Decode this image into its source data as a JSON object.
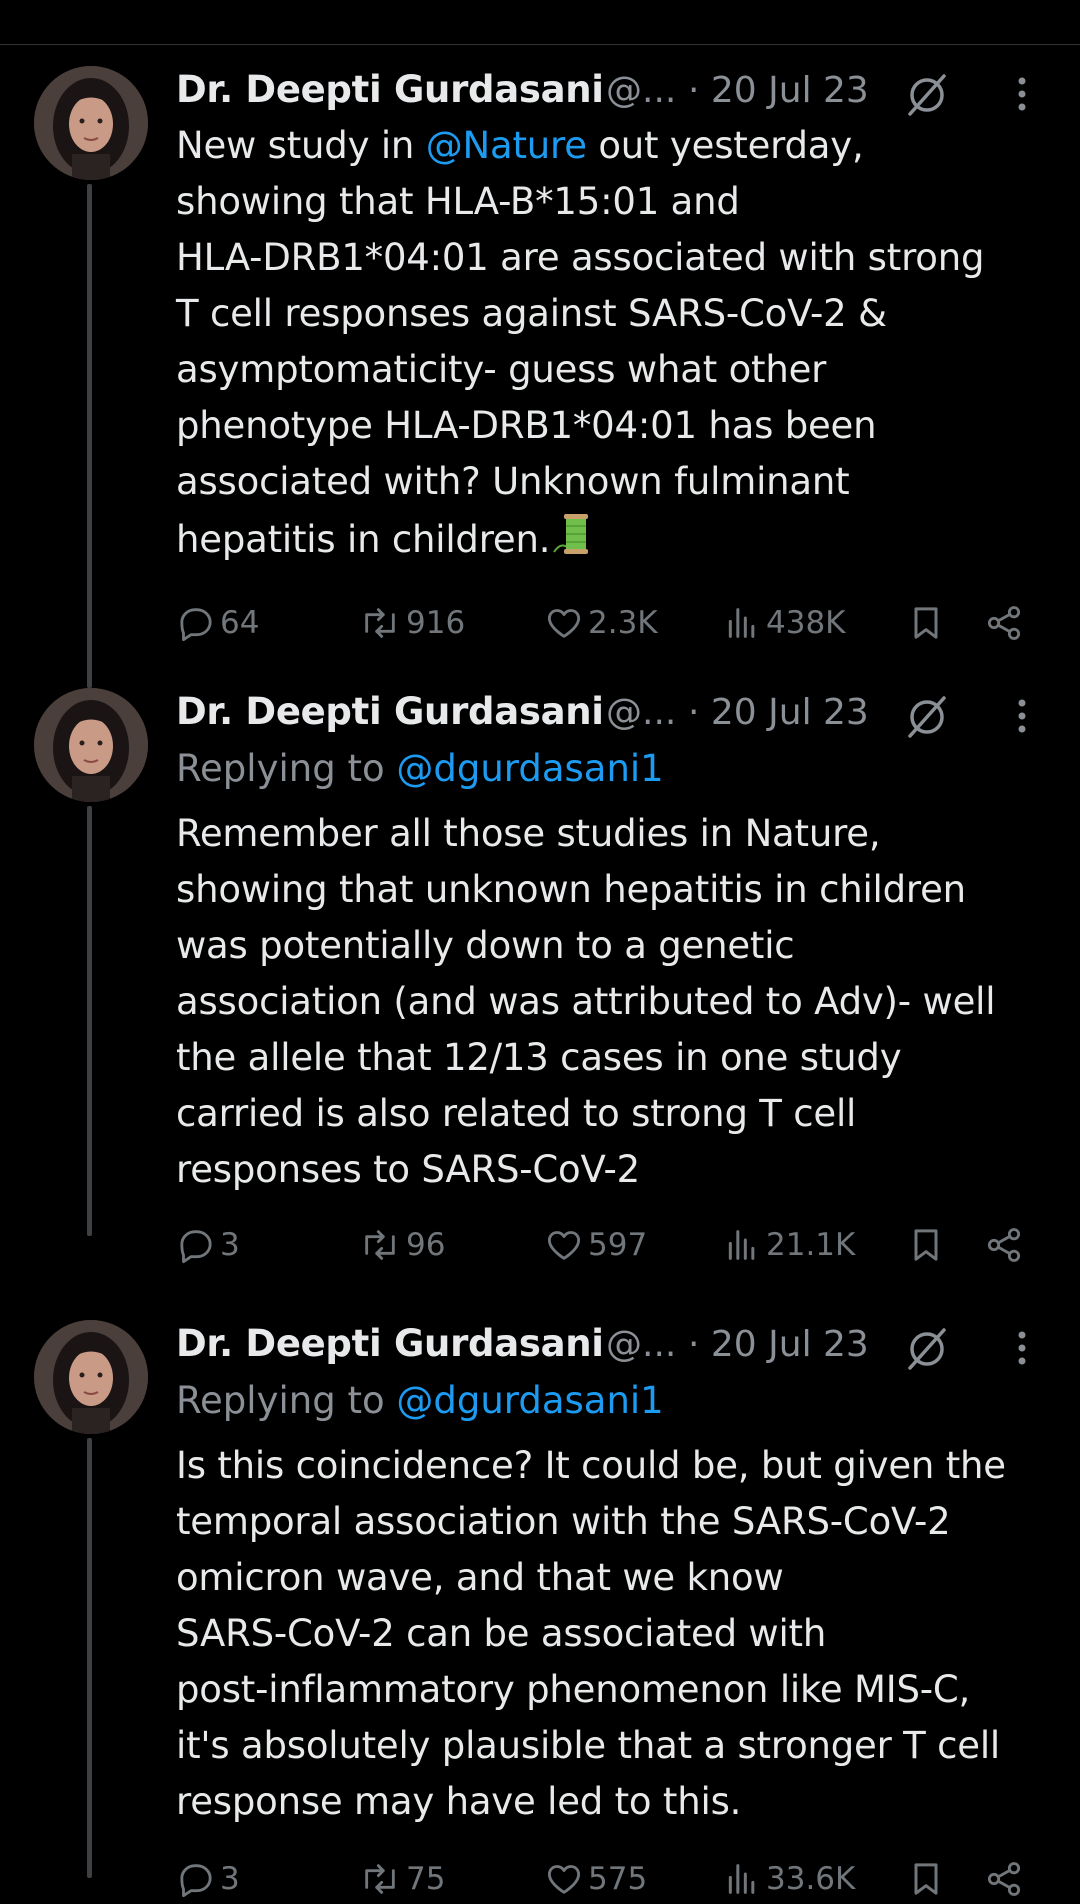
{
  "colors": {
    "background": "#000000",
    "text": "#e7e9ea",
    "secondary": "#8b9096",
    "link": "#1d9bf0",
    "thread_line": "#3e4144"
  },
  "tweets": [
    {
      "author": "Dr. Deepti Gurdasani",
      "handle": "@...",
      "date": "· 20 Jul 23",
      "replying_prefix": "",
      "replying_handle": "",
      "text_mention": "@Nature",
      "text_before": "New study in ",
      "text_after": " out yesterday,\nshowing that HLA-B*15:01 and\nHLA-DRB1*04:01 are associated with strong\nT cell responses against SARS-CoV-2 &\nasymptomaticity- guess what other\nphenotype HLA-DRB1*04:01 has been\nassociated with? Unknown fulminant\nhepatitis in children.",
      "emoji": "thread-spool",
      "replies": "64",
      "reposts": "916",
      "likes": "2.3K",
      "views": "438K"
    },
    {
      "author": "Dr. Deepti Gurdasani",
      "handle": "@...",
      "date": "· 20 Jul 23",
      "replying_prefix": "Replying to ",
      "replying_handle": "@dgurdasani1",
      "text": "Remember all those studies in Nature,\nshowing that unknown hepatitis in children\nwas potentially down to a genetic\nassociation (and was attributed to Adv)- well\nthe allele that 12/13 cases in one study\ncarried is also related to strong T cell\nresponses to SARS-CoV-2",
      "replies": "3",
      "reposts": "96",
      "likes": "597",
      "views": "21.1K"
    },
    {
      "author": "Dr. Deepti Gurdasani",
      "handle": "@...",
      "date": "· 20 Jul 23",
      "replying_prefix": "Replying to ",
      "replying_handle": "@dgurdasani1",
      "text": "Is this coincidence? It could be, but given the\ntemporal association with the SARS-CoV-2\nomicron wave, and that we know\nSARS-CoV-2 can be associated with\npost-inflammatory phenomenon like MIS-C,\nit's absolutely plausible that a stronger T cell\nresponse may have led to this.",
      "replies": "3",
      "reposts": "75",
      "likes": "575",
      "views": "33.6K"
    }
  ],
  "icons": {
    "reply": "reply-bubble-icon",
    "repost": "repost-arrows-icon",
    "like": "heart-icon",
    "views": "views-bars-icon",
    "bookmark": "bookmark-icon",
    "share": "share-icon",
    "grok": "grok-slash-icon",
    "more": "more-vertical-icon"
  }
}
